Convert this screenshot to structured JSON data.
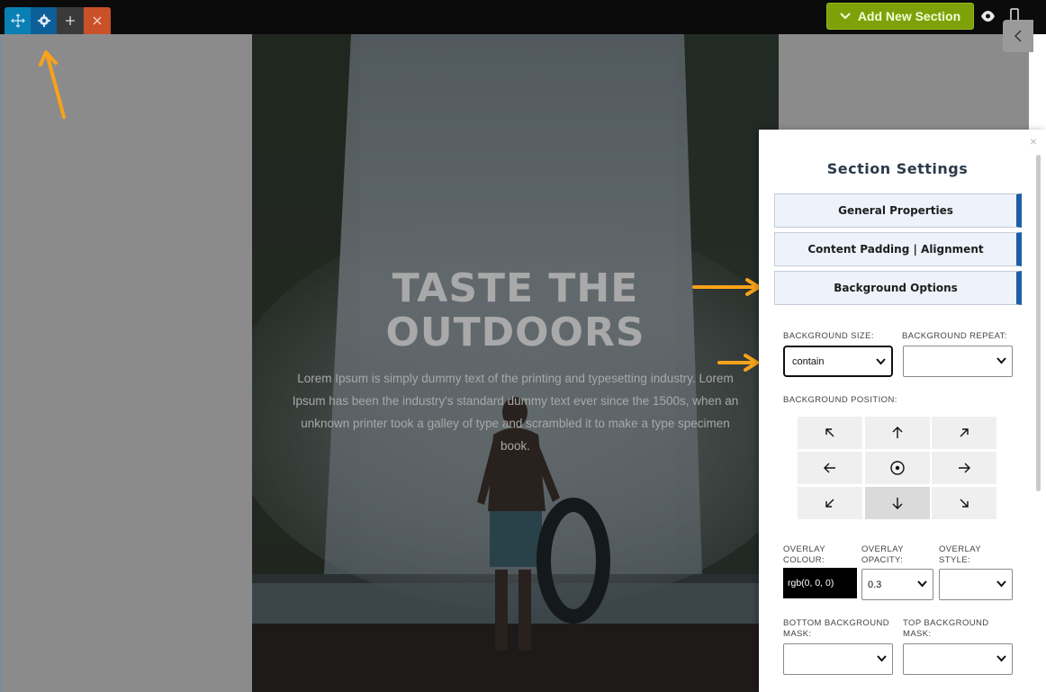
{
  "toolbar": {
    "add_section_label": "Add New Section"
  },
  "hero": {
    "title_line1": "TASTE THE",
    "title_line2": "OUTDOORS",
    "body": "Lorem Ipsum is simply dummy text of the printing and typesetting industry. Lorem Ipsum has been the industry's standard dummy text ever since the 1500s, when an unknown printer took a galley of type and scrambled it to make a type specimen book."
  },
  "panel": {
    "title": "Section Settings",
    "close_glyph": "×",
    "accordions": [
      "General Properties",
      "Content Padding | Alignment",
      "Background Options"
    ],
    "background_size": {
      "label": "BACKGROUND SIZE:",
      "value": "contain"
    },
    "background_repeat": {
      "label": "BACKGROUND REPEAT:",
      "value": ""
    },
    "background_position": {
      "label": "BACKGROUND POSITION:",
      "selected": "bottom-center"
    },
    "overlay_colour": {
      "label_line1": "OVERLAY",
      "label_line2": "COLOUR:",
      "value": "rgb(0, 0, 0)"
    },
    "overlay_opacity": {
      "label_line1": "OVERLAY",
      "label_line2": "OPACITY:",
      "value": "0.3"
    },
    "overlay_style": {
      "label_line1": "OVERLAY",
      "label_line2": "STYLE:",
      "value": ""
    },
    "bottom_mask": {
      "label_line1": "BOTTOM BACKGROUND",
      "label_line2": "MASK:",
      "value": ""
    },
    "top_mask": {
      "label_line1": "TOP BACKGROUND",
      "label_line2": "MASK:",
      "value": ""
    }
  },
  "colors": {
    "accent_green": "#7ea10a",
    "accent_blue": "#1b5fa6",
    "delete_red": "#c8512a",
    "annotation_orange": "#f7a21b"
  }
}
